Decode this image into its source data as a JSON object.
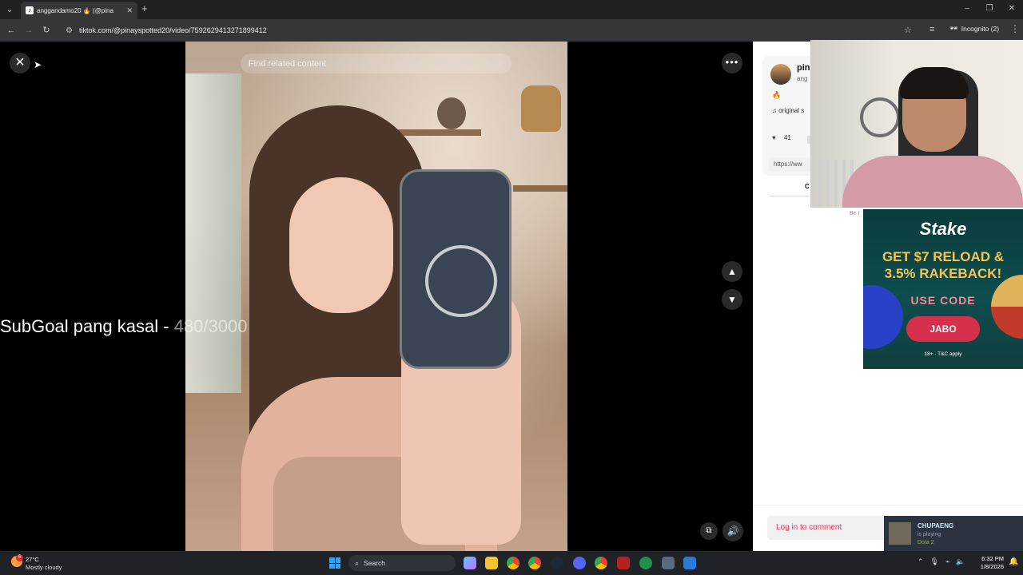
{
  "browser": {
    "tab_title": "anggandamo20 🔥 (@pina",
    "tab_close": "✕",
    "new_tab": "+",
    "url": "tiktok.com/@pinayspotted20/video/7592629413271899412",
    "incognito_label": "Incognito (2)",
    "window_controls": [
      "–",
      "❐",
      "✕"
    ]
  },
  "video_view": {
    "search_placeholder": "Find related content",
    "overlay_text": "SubGoal pang kasal - ",
    "overlay_count": "480/3000"
  },
  "side_panel": {
    "username": "pin",
    "handle": "ang",
    "music": "♫  original s",
    "like_count": "41",
    "link_text": "https://ww",
    "tab_label": "C",
    "be_first": "Be t",
    "login_to_comment": "Log in to comment"
  },
  "ad": {
    "brand": "Stake",
    "headline_line1": "GET $7 RELOAD &",
    "headline_line2": "3.5% RAKEBACK!",
    "use_code": "USE CODE",
    "code": "JABO",
    "terms": "18+ · T&C apply"
  },
  "steam_notification": {
    "name": "CHUPAENG",
    "status": "is playing",
    "game": "Dota 2"
  },
  "taskbar": {
    "weather_badge": "6",
    "temperature": "27°C",
    "condition": "Mostly cloudy",
    "search_placeholder": "Search",
    "time": "6:32 PM",
    "date": "1/8/2026"
  },
  "colors": {
    "tiktok_red": "#fe2c55",
    "stake_yellow": "#f6c453",
    "stake_button": "#d6304c",
    "steam_green": "#90ba3c"
  },
  "icons": [
    "tab-search-icon",
    "back-icon",
    "forward-icon",
    "reload-icon",
    "tune-icon",
    "star-icon",
    "incognito-icon",
    "close-icon",
    "search-icon",
    "more-icon",
    "chevron-up-icon",
    "chevron-down-icon",
    "pip-icon",
    "volume-icon",
    "heart-icon",
    "music-icon",
    "windows-icon"
  ]
}
